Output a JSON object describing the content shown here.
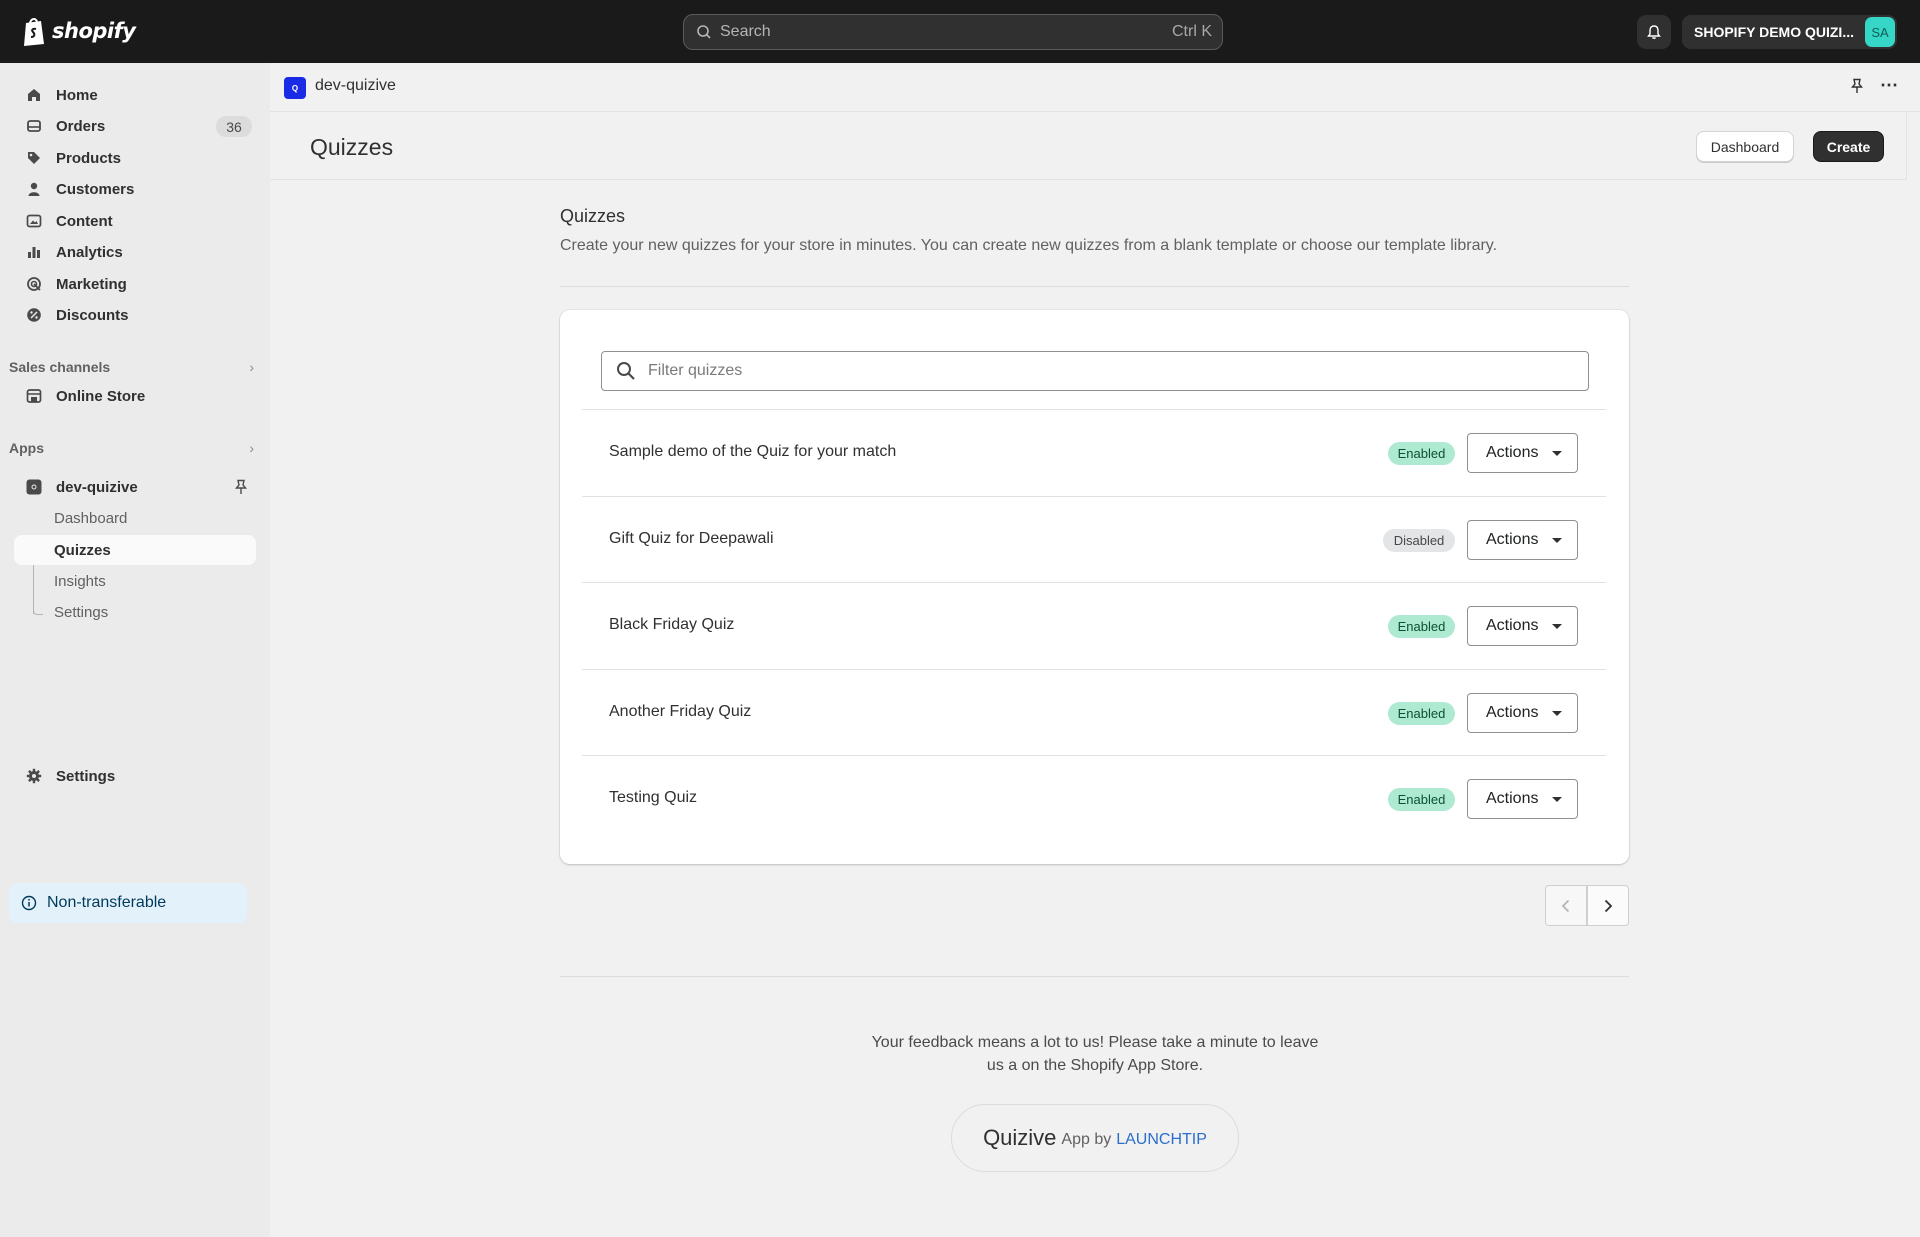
{
  "topbar": {
    "logo_text": "shopify",
    "search_placeholder": "Search",
    "search_shortcut": "Ctrl K",
    "store_name": "SHOPIFY DEMO QUIZI...",
    "avatar_initials": "SA"
  },
  "sidebar": {
    "items": [
      {
        "label": "Home",
        "icon": "home-icon"
      },
      {
        "label": "Orders",
        "icon": "orders-icon",
        "badge": "36"
      },
      {
        "label": "Products",
        "icon": "tag-icon"
      },
      {
        "label": "Customers",
        "icon": "person-icon"
      },
      {
        "label": "Content",
        "icon": "content-icon"
      },
      {
        "label": "Analytics",
        "icon": "bar-chart-icon"
      },
      {
        "label": "Marketing",
        "icon": "target-icon"
      },
      {
        "label": "Discounts",
        "icon": "discount-icon"
      }
    ],
    "sales_channels_label": "Sales channels",
    "online_store_label": "Online Store",
    "apps_label": "Apps",
    "app_name": "dev-quizive",
    "app_subitems": [
      "Dashboard",
      "Quizzes",
      "Insights",
      "Settings"
    ],
    "active_subitem": "Quizzes",
    "settings_label": "Settings",
    "non_transferable_label": "Non-transferable"
  },
  "appbar": {
    "app_icon_letter": "Q",
    "app_name": "dev-quizive"
  },
  "page": {
    "title": "Quizzes",
    "dashboard_button": "Dashboard",
    "create_button": "Create"
  },
  "section": {
    "title": "Quizzes",
    "description": "Create your new quizzes for your store in minutes. You can create new quizzes from a blank template or choose our template library."
  },
  "filter_placeholder": "Filter quizzes",
  "quizzes": [
    {
      "title": "Sample demo of the Quiz for your match",
      "status": "Enabled",
      "actions_label": "Actions"
    },
    {
      "title": "Gift Quiz for Deepawali",
      "status": "Disabled",
      "actions_label": "Actions"
    },
    {
      "title": "Black Friday Quiz",
      "status": "Enabled",
      "actions_label": "Actions"
    },
    {
      "title": "Another Friday Quiz",
      "status": "Enabled",
      "actions_label": "Actions"
    },
    {
      "title": "Testing Quiz",
      "status": "Enabled",
      "actions_label": "Actions"
    }
  ],
  "footer": {
    "feedback_line1": "Your feedback means a lot to us! Please take a minute to leave",
    "feedback_line2": "us a on the Shopify App Store.",
    "brand_name": "Quizive",
    "brand_by": "App by",
    "brand_link": "LAUNCHTIP"
  },
  "colors": {
    "topbar_bg": "#1a1a1a",
    "enabled_badge": "#aee9d1",
    "disabled_badge": "#e4e5e7",
    "app_icon": "#1a2be5",
    "avatar": "#36d6c7",
    "link": "#2c6ecb"
  }
}
